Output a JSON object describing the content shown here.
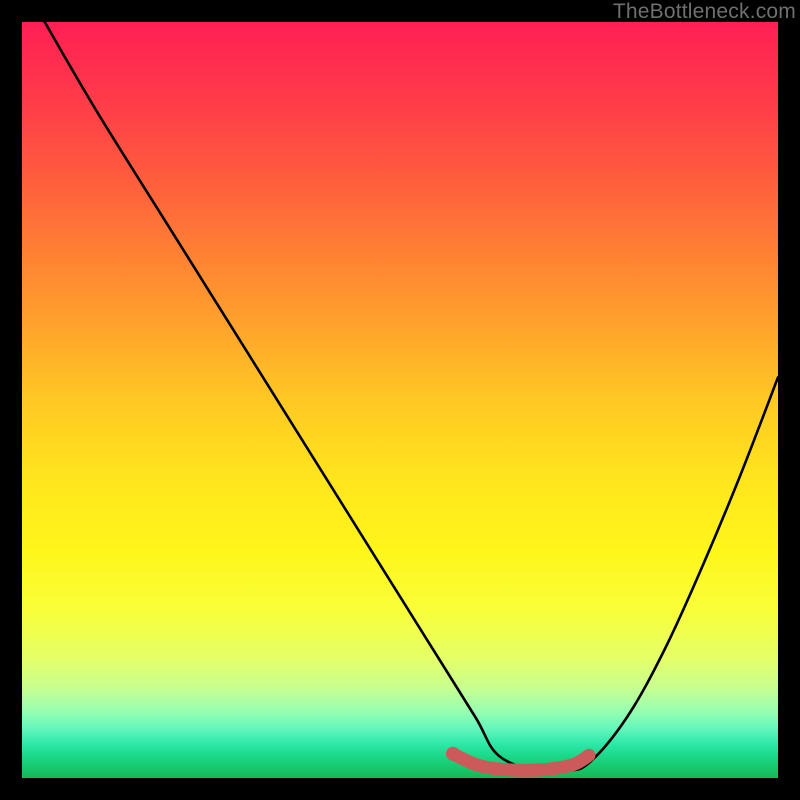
{
  "watermark": {
    "text": "TheBottleneck.com"
  },
  "chart_data": {
    "type": "line",
    "title": "",
    "xlabel": "",
    "ylabel": "",
    "xlim": [
      0,
      100
    ],
    "ylim": [
      0,
      100
    ],
    "series": [
      {
        "name": "bottleneck-curve",
        "color": "#000000",
        "x": [
          3,
          10,
          20,
          30,
          40,
          50,
          55,
          60,
          63,
          68,
          72,
          75,
          80,
          85,
          90,
          95,
          100
        ],
        "y": [
          100,
          88,
          72,
          56,
          40,
          24,
          16,
          8,
          3,
          1,
          1,
          2,
          8,
          17,
          28,
          40,
          53
        ]
      },
      {
        "name": "optimal-band",
        "color": "#cc5a5a",
        "x": [
          57,
          60,
          63,
          67,
          70,
          73,
          75
        ],
        "y": [
          3.2,
          1.8,
          1.2,
          1.0,
          1.2,
          1.8,
          3.0
        ]
      }
    ],
    "markers": [
      {
        "name": "optimal-start-dot",
        "x": 57,
        "y": 3.2,
        "color": "#cc5a5a"
      }
    ],
    "gradient_stops": [
      {
        "pos": 0,
        "color": "#ff1f54"
      },
      {
        "pos": 50,
        "color": "#ffc823"
      },
      {
        "pos": 78,
        "color": "#f8ff3a"
      },
      {
        "pos": 100,
        "color": "#15b854"
      }
    ]
  }
}
